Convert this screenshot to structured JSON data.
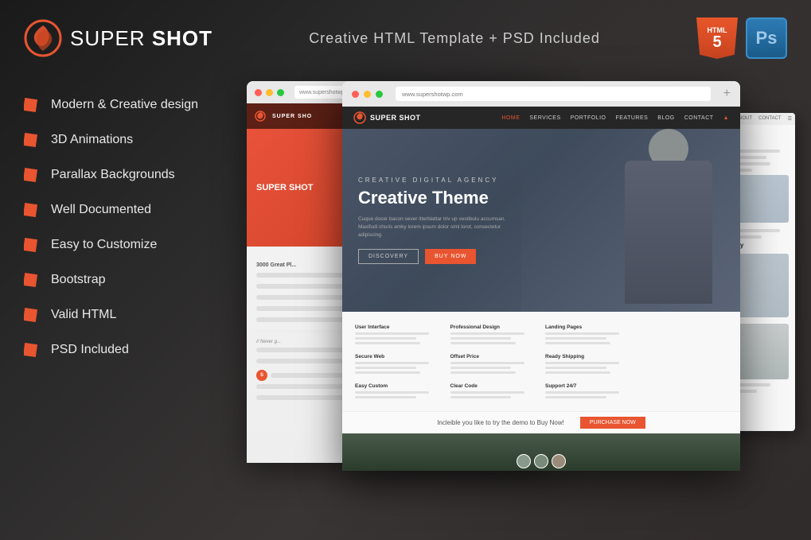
{
  "header": {
    "logo_text_light": "SUPER ",
    "logo_text_bold": "SHOT",
    "subtitle": "Creative HTML Template  + PSD Included",
    "badge_html": "HTML",
    "badge_html_num": "5",
    "badge_ps": "Ps"
  },
  "features": [
    {
      "id": "modern",
      "label": "Modern & Creative design"
    },
    {
      "id": "3d",
      "label": "3D Animations"
    },
    {
      "id": "parallax",
      "label": "Parallax Backgrounds"
    },
    {
      "id": "docs",
      "label": "Well Documented"
    },
    {
      "id": "customize",
      "label": "Easy to Customize"
    },
    {
      "id": "bootstrap",
      "label": "Bootstrap"
    },
    {
      "id": "html",
      "label": "Valid HTML"
    },
    {
      "id": "psd",
      "label": "PSD Included"
    }
  ],
  "browser_bg": {
    "dot_colors": [
      "#ff5f57",
      "#ffbd2e",
      "#28c840"
    ],
    "address": "www.supershotwp.com"
  },
  "browser_main": {
    "address": "www.supershotwp.com",
    "plus_icon": "+"
  },
  "site_nav": {
    "logo": "SUPER SHOT",
    "links": [
      "HOME",
      "SERVICES",
      "PORTFOLIO",
      "FEATURES",
      "BLOG",
      "CONTACT",
      "▸"
    ]
  },
  "site_hero": {
    "subtitle": "Creative Digital Agency",
    "title": "Creative Theme",
    "description": "Cuque docer bacon sever itterblattar triv up vestibulu accumsan. Maxifudi churis amky lorem ipsum dolor simi lorot, consectetur adipiscing.",
    "btn1": "DISCOVERY",
    "btn2": "BUY NOW"
  },
  "site_features_titles": [
    "User Interface",
    "Professional Design",
    "Landing Pages",
    "Secure Web",
    "Offset Price",
    "Ready Shipping",
    "Easy Custom",
    "Clear Code",
    "Support 24/7"
  ],
  "site_cta": {
    "text": "Incleible you like to try the demo to Buy Now!",
    "button": "PURCHASE NOW"
  },
  "colors": {
    "accent": "#e85530",
    "dark_bg": "#2d2d2d",
    "white": "#ffffff",
    "badge_ps_bg": "#1a6fa0"
  }
}
